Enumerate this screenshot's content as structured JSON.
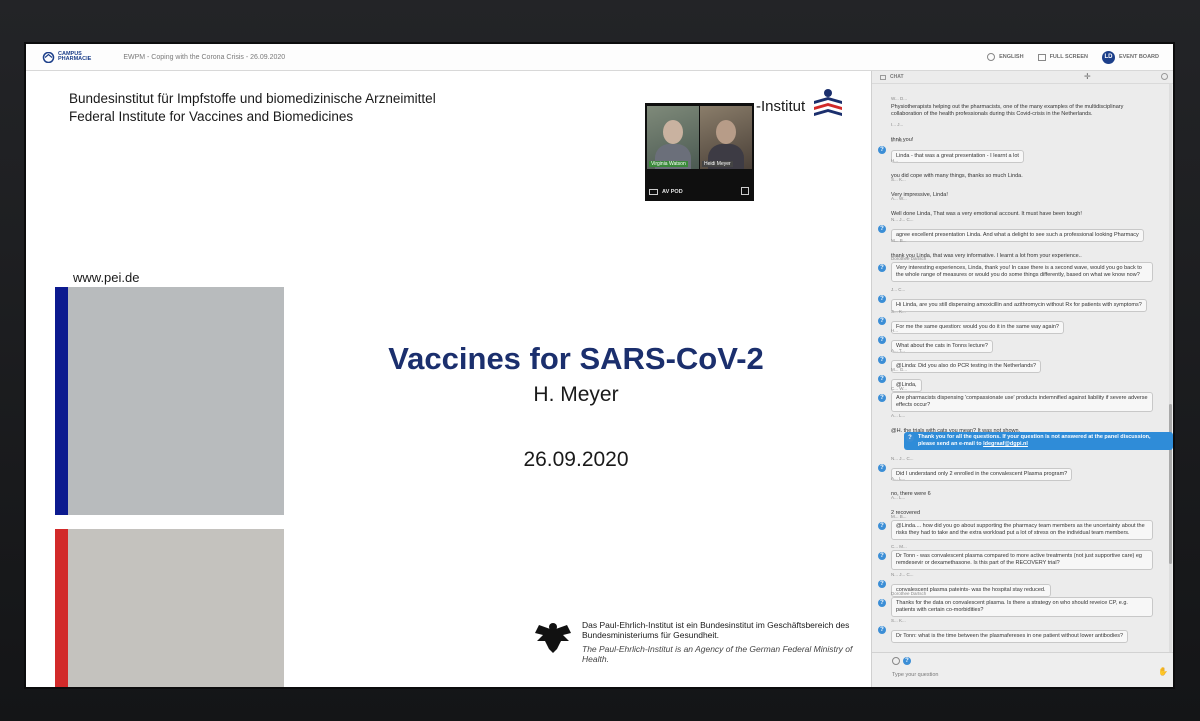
{
  "topbar": {
    "logo_line1": "CAMPUS",
    "logo_line2": "PHARMACIE",
    "event_title": "EWPM - Coping with the Corona Crisis - 26.09.2020",
    "language_label": "ENGLISH",
    "fullscreen_label": "FULL SCREEN",
    "avatar_initials": "LD",
    "event_board_label": "EVENT BOARD"
  },
  "slide": {
    "org_line1": "Bundesinstitut für Impfstoffe und biomedizinische Arzneimittel",
    "org_line2": "Federal Institute for Vaccines and Biomedicines",
    "institute_name": "-Institut",
    "url": "www.pei.de",
    "title": "Vaccines for SARS-CoV-2",
    "author": "H. Meyer",
    "date": "26.09.2020",
    "footer_de": "Das Paul-Ehrlich-Institut ist ein Bundesinstitut im Geschäftsbereich des Bundesministeriums für Gesundheit.",
    "footer_en": "The Paul-Ehrlich-Institut is an Agency of the German Federal Ministry of Health.",
    "colors": {
      "blue": "#0c1a8f",
      "red": "#d22a2a",
      "title": "#1b2f6d"
    }
  },
  "av_pod": {
    "label": "AV POD",
    "participants": [
      "Virginia Watson",
      "Heidi Meyer"
    ]
  },
  "chat": {
    "header_label": "CHAT",
    "input_placeholder": "Type your question",
    "messages": [
      {
        "sender": "W... D...",
        "text": "Physiotherapists helping out the pharmacists, one of the many examples of the multidisciplinary collaboration of the health professionals during this Covid-crisis in the Netherlands."
      },
      {
        "sender": "I... J...",
        "text": "thnk you!"
      },
      {
        "sender": "J... M...",
        "text": "Linda - that was a great presentation - I learnt a lot"
      },
      {
        "sender": "H...",
        "text": "you did cope with many things, thanks so much Linda."
      },
      {
        "sender": "S... K...",
        "text": "Very impressive, Linda!"
      },
      {
        "sender": "A... W...",
        "text": "Well done Linda, That was a very emotional account. It must have been tough!"
      },
      {
        "sender": "N... J... C...",
        "text": "agree excellent presentation Linda. And what a delight to see such a professional looking Pharmacy"
      },
      {
        "sender": "M... B...",
        "text": "thank you Linda, that was very informative. I learnt a lot from your experience.."
      },
      {
        "sender": "Dorothee Dartsch",
        "text": "Very interesting experiences, Linda, thank you! In case there is a second wave, would you go back to the whole range of measures or would you do some things differently, based on what we know now?"
      },
      {
        "sender": "J... C...",
        "text": "Hi Linda, are you still dispensing amoxicillin and azithromycin without Rx for patients with symptoms?"
      },
      {
        "sender": "S... K...",
        "text": "For me the same question: would you do it in the same way again?"
      },
      {
        "sender": "H...",
        "text": "What about the cats in Tonns lecture?"
      },
      {
        "sender": "A... T...",
        "text": "@Linda: Did you also do PCR testing in the Netherlands?"
      },
      {
        "sender": "M... G...",
        "text": "@Linda,"
      },
      {
        "sender": "C... W...",
        "text": "Are pharmacists dispensing 'compassionate use' products indemnified against liability if severe adverse effects occur?"
      },
      {
        "sender": "A... L...",
        "text": "@H. the trials with cats you mean? It was not shown."
      },
      {
        "sender": "",
        "text": "Thank you for all the questions. If your question is not answered at the panel discussion, please send an e-mail to",
        "email": "ldegraaf@dgpi.nl"
      },
      {
        "sender": "N... J... C...",
        "text": "Did I understand only 2 enrolled in the convalescent Plasma program?"
      },
      {
        "sender": "A... L...",
        "text": "no, there were 6"
      },
      {
        "sender": "A... L...",
        "text": "2 recovered"
      },
      {
        "sender": "M... B...",
        "text": "@Linda.... how did you go about supporting the pharmacy team members as the uncertainty about the risks they had to take and the extra workload put a lot of stress on the individual team members."
      },
      {
        "sender": "C... M...",
        "text": "Dr Tonn - was convalescent plasma compared to more active treatments (not just supportive care) eg remdesevir or dexamethasone. Is this part of the RECOVERY trial?"
      },
      {
        "sender": "N... J... C...",
        "text": "convalescent plasma pateints- was the hospital stay reduced."
      },
      {
        "sender": "Dorothee Dartsch",
        "text": "Thanks for the data on convalescent plasma. Is there a strategy on who should reveice CP, e.g. patients with certain co-morbidities?"
      },
      {
        "sender": "S... K...",
        "text": "Dr Tonn: what is the time between the plasmafereses in one patient without lower antibodies?"
      }
    ]
  }
}
